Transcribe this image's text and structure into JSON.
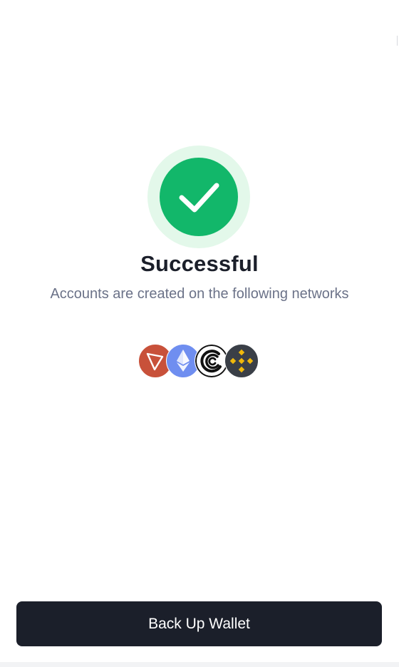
{
  "status": {
    "title": "Successful",
    "subtitle": "Accounts are created on the following networks"
  },
  "networks": [
    {
      "icon": "tron-icon",
      "color": "#c8513a"
    },
    {
      "icon": "ethereum-icon",
      "color": "#6f8ef0"
    },
    {
      "icon": "bittorrent-icon",
      "color": "#111111"
    },
    {
      "icon": "bnb-icon",
      "color": "#3a3f47"
    }
  ],
  "colors": {
    "success": "#12b76a",
    "success_halo": "#e3f8ea",
    "button_bg": "#1b1f2a",
    "title_text": "#1b1f2a",
    "subtitle_text": "#6b7288"
  },
  "actions": {
    "backup_label": "Back Up Wallet"
  }
}
